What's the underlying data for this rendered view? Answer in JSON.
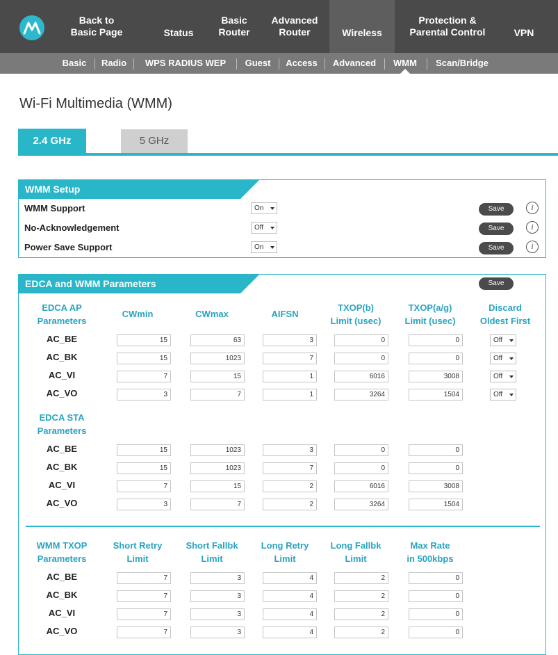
{
  "nav": {
    "items": [
      {
        "label1": "Back to",
        "label2": "Basic Page"
      },
      {
        "label1": "Status",
        "label2": ""
      },
      {
        "label1": "Basic",
        "label2": "Router"
      },
      {
        "label1": "Advanced",
        "label2": "Router"
      },
      {
        "label1": "Wireless",
        "label2": ""
      },
      {
        "label1": "Protection &",
        "label2": "Parental Control"
      },
      {
        "label1": "VPN",
        "label2": ""
      }
    ],
    "sub_items": [
      "Basic",
      "Radio",
      "WPS RADIUS WEP",
      "Guest",
      "Access",
      "Advanced",
      "WMM",
      "Scan/Bridge"
    ]
  },
  "page": {
    "title": "Wi-Fi Multimedia (WMM)"
  },
  "bands": {
    "active": "2.4 GHz",
    "inactive": "5 GHz"
  },
  "setup": {
    "title": "WMM Setup",
    "save_label": "Save",
    "info_glyph": "i",
    "rows": [
      {
        "label": "WMM Support",
        "value": "On"
      },
      {
        "label": "No-Acknowledgement",
        "value": "Off"
      },
      {
        "label": "Power Save Support",
        "value": "On"
      }
    ]
  },
  "edca": {
    "title": "EDCA and WMM Parameters",
    "save_label": "Save",
    "ap_headers": [
      [
        "EDCA AP",
        "Parameters"
      ],
      [
        "CWmin",
        ""
      ],
      [
        "CWmax",
        ""
      ],
      [
        "AIFSN",
        ""
      ],
      [
        "TXOP(b)",
        "Limit (usec)"
      ],
      [
        "TXOP(a/g)",
        "Limit (usec)"
      ],
      [
        "Discard",
        "Oldest First"
      ]
    ],
    "ap_rows": [
      {
        "label": "AC_BE",
        "values": [
          "15",
          "63",
          "3",
          "0",
          "0"
        ],
        "discard": "Off"
      },
      {
        "label": "AC_BK",
        "values": [
          "15",
          "1023",
          "7",
          "0",
          "0"
        ],
        "discard": "Off"
      },
      {
        "label": "AC_VI",
        "values": [
          "7",
          "15",
          "1",
          "6016",
          "3008"
        ],
        "discard": "Off"
      },
      {
        "label": "AC_VO",
        "values": [
          "3",
          "7",
          "1",
          "3264",
          "1504"
        ],
        "discard": "Off"
      }
    ],
    "sta_header": [
      "EDCA STA",
      "Parameters"
    ],
    "sta_rows": [
      {
        "label": "AC_BE",
        "values": [
          "15",
          "1023",
          "3",
          "0",
          "0"
        ]
      },
      {
        "label": "AC_BK",
        "values": [
          "15",
          "1023",
          "7",
          "0",
          "0"
        ]
      },
      {
        "label": "AC_VI",
        "values": [
          "7",
          "15",
          "2",
          "6016",
          "3008"
        ]
      },
      {
        "label": "AC_VO",
        "values": [
          "3",
          "7",
          "2",
          "3264",
          "1504"
        ]
      }
    ],
    "txop_headers": [
      [
        "WMM TXOP",
        "Parameters"
      ],
      [
        "Short Retry",
        "Limit"
      ],
      [
        "Short Fallbk",
        "Limit"
      ],
      [
        "Long Retry",
        "Limit"
      ],
      [
        "Long Fallbk",
        "Limit"
      ],
      [
        "Max Rate",
        "in 500kbps"
      ]
    ],
    "txop_rows": [
      {
        "label": "AC_BE",
        "values": [
          "7",
          "3",
          "4",
          "2",
          "0"
        ]
      },
      {
        "label": "AC_BK",
        "values": [
          "7",
          "3",
          "4",
          "2",
          "0"
        ]
      },
      {
        "label": "AC_VI",
        "values": [
          "7",
          "3",
          "4",
          "2",
          "0"
        ]
      },
      {
        "label": "AC_VO",
        "values": [
          "7",
          "3",
          "4",
          "2",
          "0"
        ]
      }
    ]
  },
  "colors": {
    "accent": "#29b6c8",
    "nav_bg": "#4a4a4a",
    "subnav_bg": "#7a7a7a"
  }
}
